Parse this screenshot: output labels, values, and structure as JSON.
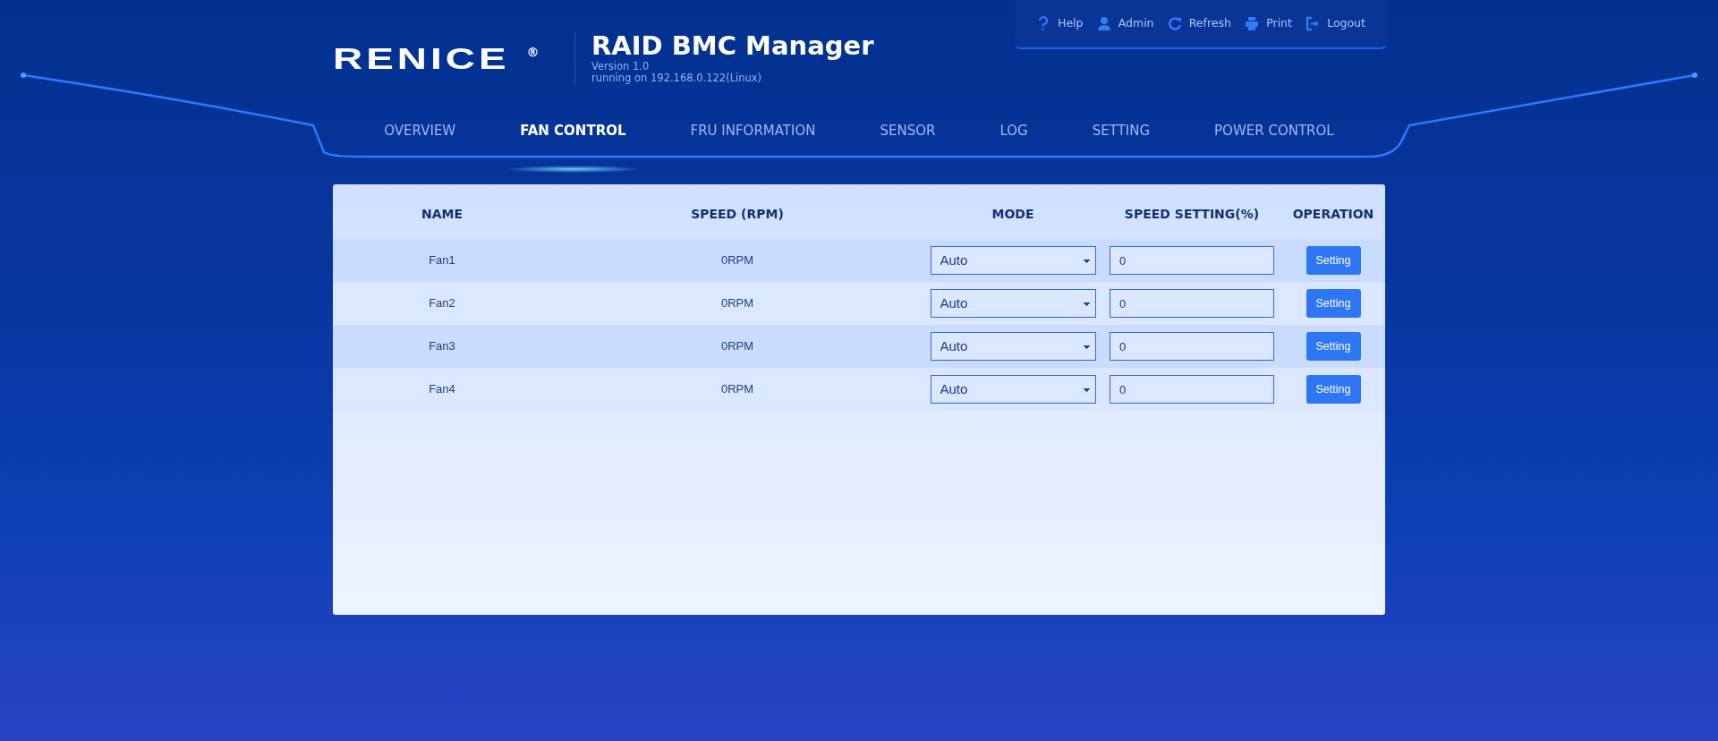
{
  "header": {
    "logo": "RENICE",
    "logo_mark": "®",
    "title": "RAID BMC Manager",
    "version": "Version 1.0",
    "running_on": "running on 192.168.0.122(Linux)"
  },
  "toolbar": [
    {
      "kind": "help",
      "label": "Help"
    },
    {
      "kind": "user",
      "label": "Admin"
    },
    {
      "kind": "refresh",
      "label": "Refresh"
    },
    {
      "kind": "print",
      "label": "Print"
    },
    {
      "kind": "logout",
      "label": "Logout"
    }
  ],
  "nav": [
    {
      "label": "OVERVIEW",
      "selected": false
    },
    {
      "label": "FAN CONTROL",
      "selected": true
    },
    {
      "label": "FRU INFORMATION",
      "selected": false
    },
    {
      "label": "SENSOR",
      "selected": false
    },
    {
      "label": "LOG",
      "selected": false
    },
    {
      "label": "SETTING",
      "selected": false
    },
    {
      "label": "POWER CONTROL",
      "selected": false
    }
  ],
  "table": {
    "columns": [
      "NAME",
      "SPEED (RPM)",
      "MODE",
      "SPEED SETTING(%)",
      "OPERATION"
    ],
    "rows": [
      {
        "name": "Fan1",
        "speed": "0RPM",
        "mode": "Auto",
        "speed_setting": "0",
        "button": "Setting"
      },
      {
        "name": "Fan2",
        "speed": "0RPM",
        "mode": "Auto",
        "speed_setting": "0",
        "button": "Setting"
      },
      {
        "name": "Fan3",
        "speed": "0RPM",
        "mode": "Auto",
        "speed_setting": "0",
        "button": "Setting"
      },
      {
        "name": "Fan4",
        "speed": "0RPM",
        "mode": "Auto",
        "speed_setting": "0",
        "button": "Setting"
      }
    ]
  }
}
